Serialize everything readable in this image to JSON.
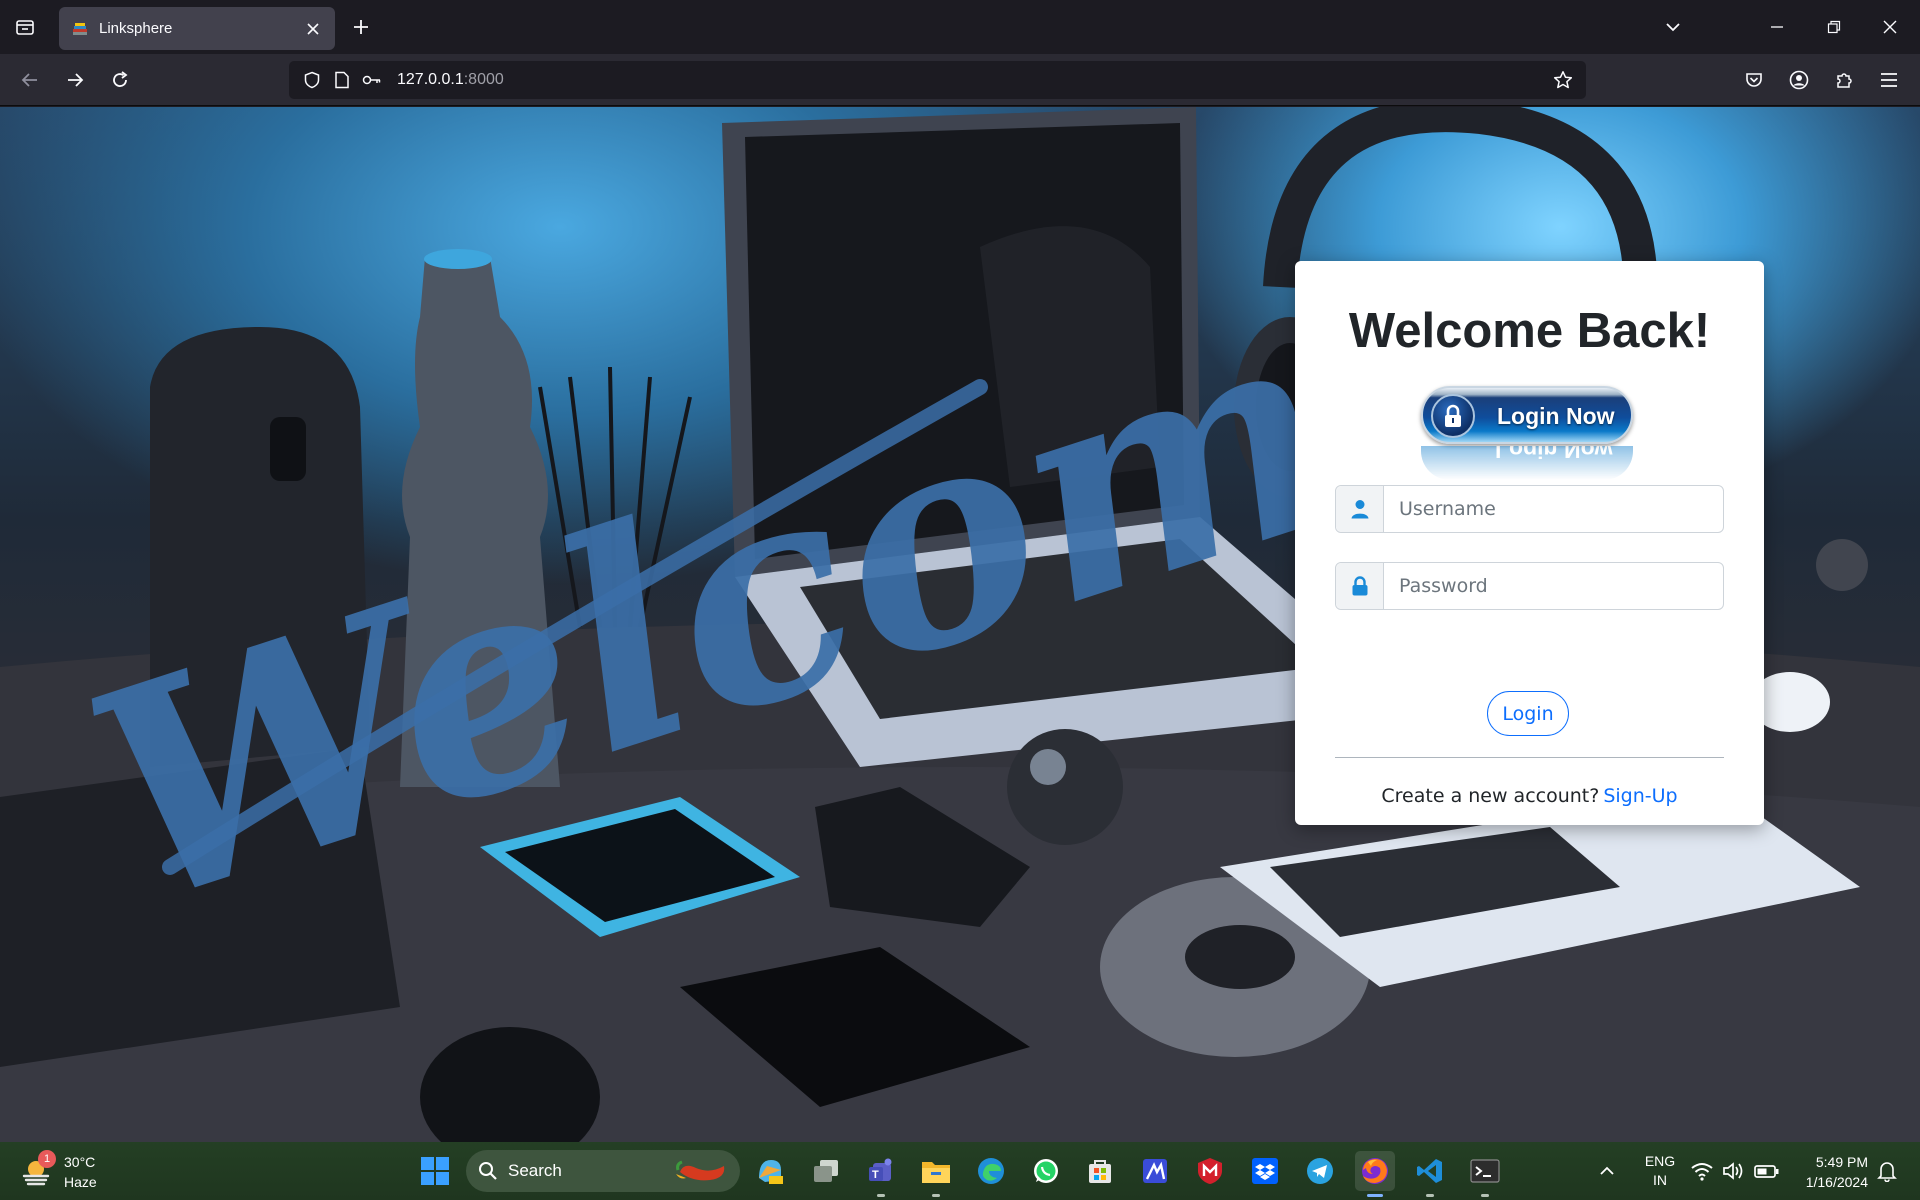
{
  "browser": {
    "tab_title": "Linksphere",
    "url_host": "127.0.0.1",
    "url_port": ":8000"
  },
  "page": {
    "background_script_text": "Welcome",
    "card": {
      "title": "Welcome Back!",
      "badge_label": "Login Now",
      "username_placeholder": "Username",
      "password_placeholder": "Password",
      "login_button": "Login",
      "signup_prompt": "Create a new account?",
      "signup_link": "Sign-Up"
    }
  },
  "taskbar": {
    "weather_badge": "1",
    "weather_temp": "30°C",
    "weather_condition": "Haze",
    "search_label": "Search",
    "apps": [
      "copilot-icon",
      "task-view-icon",
      "teams-icon",
      "file-explorer-icon",
      "edge-icon",
      "whatsapp-icon",
      "store-icon",
      "app-icon",
      "mcafee-icon",
      "dropbox-icon",
      "telegram-icon",
      "firefox-icon",
      "vscode-icon",
      "terminal-icon"
    ],
    "lang_line1": "ENG",
    "lang_line2": "IN",
    "time": "5:49 PM",
    "date": "1/16/2024"
  },
  "colors": {
    "link": "#0d6efd",
    "input_icon": "#1a8ad8",
    "script_text": "#3b6fa8"
  }
}
